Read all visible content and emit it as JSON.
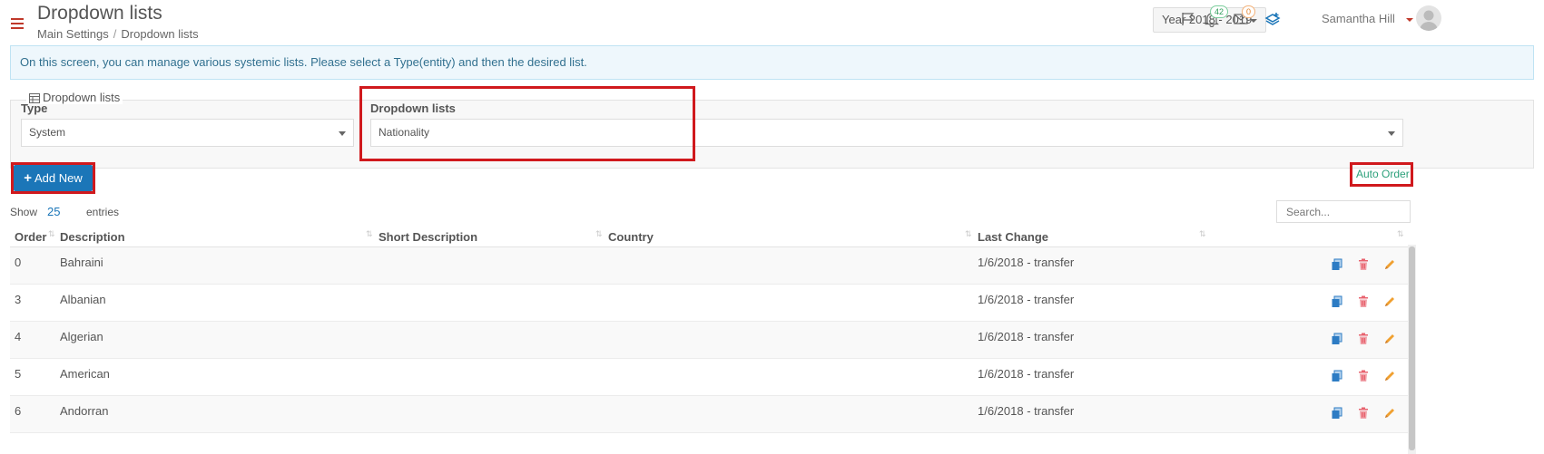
{
  "header": {
    "title": "Dropdown lists",
    "breadcrumb": [
      "Main Settings",
      "Dropdown lists"
    ],
    "year_select": "Year 2018 - 2019",
    "notifications_count": "42",
    "messages_count": "0",
    "user_name": "Samantha Hill"
  },
  "info_banner": "On this screen, you can manage various systemic lists. Please select a Type(entity) and then the desired list.",
  "filter": {
    "legend": "Dropdown lists",
    "type_label": "Type",
    "type_value": "System",
    "list_label": "Dropdown lists",
    "list_value": "Nationality"
  },
  "toolbar": {
    "add_new": "Add New",
    "auto_order": "Auto Order",
    "show_label": "Show",
    "page_size": "25",
    "entries_label": "entries",
    "search_placeholder": "Search..."
  },
  "table": {
    "columns": [
      "Order",
      "Description",
      "Short Description",
      "Country",
      "Last Change"
    ],
    "rows": [
      {
        "order": "0",
        "description": "Bahraini",
        "short_description": "",
        "country": "",
        "last_change": "1/6/2018 - transfer"
      },
      {
        "order": "3",
        "description": "Albanian",
        "short_description": "",
        "country": "",
        "last_change": "1/6/2018 - transfer"
      },
      {
        "order": "4",
        "description": "Algerian",
        "short_description": "",
        "country": "",
        "last_change": "1/6/2018 - transfer"
      },
      {
        "order": "5",
        "description": "American",
        "short_description": "",
        "country": "",
        "last_change": "1/6/2018 - transfer"
      },
      {
        "order": "6",
        "description": "Andorran",
        "short_description": "",
        "country": "",
        "last_change": "1/6/2018 - transfer"
      }
    ]
  },
  "colors": {
    "accent_blue": "#1b76b8",
    "highlight_red": "#d0191d",
    "delete_red": "#e8636f",
    "edit_orange": "#f0a030",
    "auto_order_green": "#2ca07a"
  },
  "icons": [
    "menu-icon",
    "flag-icon",
    "bell-icon",
    "envelope-icon",
    "layers-icon",
    "table-icon",
    "copy-icon",
    "trash-icon",
    "pencil-icon"
  ]
}
